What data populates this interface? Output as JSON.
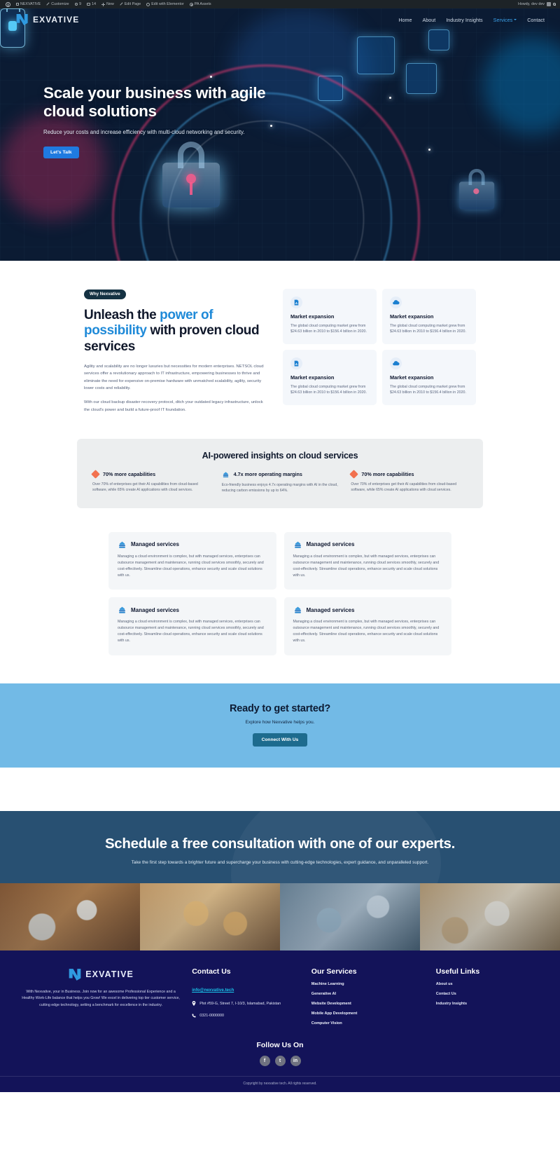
{
  "adminbar": {
    "items": [
      {
        "icon": "wordpress-logo-icon",
        "label": ""
      },
      {
        "icon": "home-icon",
        "label": "NEXVATIVE"
      },
      {
        "icon": "pencil-icon",
        "label": "Customize"
      },
      {
        "icon": "comment-circle-icon",
        "label": "9"
      },
      {
        "icon": "comment-icon",
        "label": "14"
      },
      {
        "icon": "plus-icon",
        "label": "New"
      },
      {
        "icon": "pencil-icon",
        "label": "Edit Page"
      },
      {
        "icon": "elementor-icon",
        "label": "Edit with Elementor"
      },
      {
        "icon": "pa-assets-icon",
        "label": "PA Assets"
      }
    ],
    "howdy": "Howdy, dev dev",
    "search_icon": "search-icon"
  },
  "header": {
    "logo_text": "EXVATIVE",
    "logo_mark": "nexvative-n-logo-icon",
    "nav": [
      {
        "label": "Home",
        "active": false
      },
      {
        "label": "About",
        "active": false
      },
      {
        "label": "Industry Insights",
        "active": false
      },
      {
        "label": "Services",
        "active": true,
        "has_dropdown": true
      },
      {
        "label": "Contact",
        "active": false
      }
    ]
  },
  "hero": {
    "title": "Scale your business with agile cloud solutions",
    "subtitle": "Reduce your costs and increase efficiency with multi-cloud networking and security.",
    "cta": "Let's Talk"
  },
  "why": {
    "badge": "Why Nexvative",
    "heading_part1": "Unleash the ",
    "heading_hl1": "power of possibility",
    "heading_part2": " with proven cloud services",
    "paragraph1": "Agility and scalability are no longer luxuries but necessities for modern enterprises. NETSOL cloud services offer a revolutionary approach to IT infrastructure, empowering businesses to thrive and eliminate the need for expensive on-premise hardware with unmatched scalability, agility, security lower costs and reliability.",
    "paragraph2": "With our cloud backup disaster recovery protocol, ditch your outdated legacy infrastructure, unlock the cloud's power and build a future-proof IT foundation.",
    "cards": [
      {
        "icon": "document-chart-icon",
        "title": "Market expansion",
        "text": "The global cloud computing market grew from $24.63 billion in 2010 to $156.4 billion in 2020."
      },
      {
        "icon": "cloud-icon",
        "title": "Market expansion",
        "text": "The global cloud computing market grew from $24.63 billion in 2010 to $156.4 billion in 2020."
      },
      {
        "icon": "document-chart-icon",
        "title": "Market expansion",
        "text": "The global cloud computing market grew from $24.63 billion in 2010 to $156.4 billion in 2020."
      },
      {
        "icon": "cloud-icon",
        "title": "Market expansion",
        "text": "The global cloud computing market grew from $24.63 billion in 2010 to $156.4 billion in 2020."
      }
    ]
  },
  "insights": {
    "title": "AI-powered insights on cloud services",
    "items": [
      {
        "icon": "diamond-icon",
        "title": "70% more capabilities",
        "text": "Over 70% of enterprises get their AI capabilities from cloud-based software, while 65% create AI applications with cloud services."
      },
      {
        "icon": "cloud-server-icon",
        "title": "4.7x more operating margins",
        "text": "Eco-friendly business enjoys 4.7x operating margins with AI in the cloud, reducing carbon emissions by up to 64%."
      },
      {
        "icon": "diamond-icon",
        "title": "70% more capabilities",
        "text": "Over 70% of enterprises get their AI capabilities from cloud-based software, while 65% create AI applications with cloud services."
      }
    ]
  },
  "managed": {
    "cards": [
      {
        "icon": "cloud-server-icon",
        "title": "Managed services",
        "text": "Managing a cloud environment is complex, but with managed services, enterprises can outsource management and maintenance, running cloud services smoothly, securely and cost-effectively. Streamline cloud operations, enhance security and scale cloud solutions with us."
      },
      {
        "icon": "cloud-server-icon",
        "title": "Managed services",
        "text": "Managing a cloud environment is complex, but with managed services, enterprises can outsource management and maintenance, running cloud services smoothly, securely and cost-effectively. Streamline cloud operations, enhance security and scale cloud solutions with us."
      },
      {
        "icon": "cloud-server-icon",
        "title": "Managed services",
        "text": "Managing a cloud environment is complex, but with managed services, enterprises can outsource management and maintenance, running cloud services smoothly, securely and cost-effectively. Streamline cloud operations, enhance security and scale cloud solutions with us."
      },
      {
        "icon": "cloud-server-icon",
        "title": "Managed services",
        "text": "Managing a cloud environment is complex, but with managed services, enterprises can outsource management and maintenance, running cloud services smoothly, securely and cost-effectively. Streamline cloud operations, enhance security and scale cloud solutions with us."
      }
    ]
  },
  "cta": {
    "heading": "Ready to get started?",
    "sub": "Explore how Nexvative helps you.",
    "button": "Connect With Us"
  },
  "consult": {
    "heading": "Schedule a free consultation with one of our experts.",
    "sub": "Take the first step towards a brighter future and supercharge your business with cutting-edge technologies, expert guidance, and unparalleled support."
  },
  "footer": {
    "logo_text": "EXVATIVE",
    "about": "With Nexvative, your in Business. Join now for an awesome Professional Experience and a Healthy Work-Life balance that helps you Grow! We excel in delivering top tier customer service, cutting edge technology, setting a benchmark for excellence in the industry.",
    "contact_title": "Contact Us",
    "email": "info@nexvative.tech",
    "address_icon": "location-pin-icon",
    "address": "Plot #59-G, Street 7, I-10/3, Islamabad, Pakistan",
    "phone_icon": "phone-icon",
    "phone": "0321-0000000",
    "services_title": "Our Services",
    "services": [
      "Machine Learning",
      "Generative AI",
      "Website Development",
      "Mobile App Development",
      "Computer Vision"
    ],
    "links_title": "Useful Links",
    "links": [
      "About us",
      "Contact Us",
      "Industry Insights"
    ],
    "follow_title": "Follow Us On",
    "socials": [
      {
        "name": "facebook-icon",
        "glyph": "f"
      },
      {
        "name": "twitter-icon",
        "glyph": "t"
      },
      {
        "name": "linkedin-icon",
        "glyph": "in"
      }
    ],
    "copyright": "Copyright by nexvative tech. All rights reserved."
  },
  "colors": {
    "brand_blue": "#1f8ad8",
    "navy": "#131359",
    "cta_blue": "#72bae6",
    "accent_orange": "#f2714f",
    "email_cyan": "#19c1e8"
  }
}
